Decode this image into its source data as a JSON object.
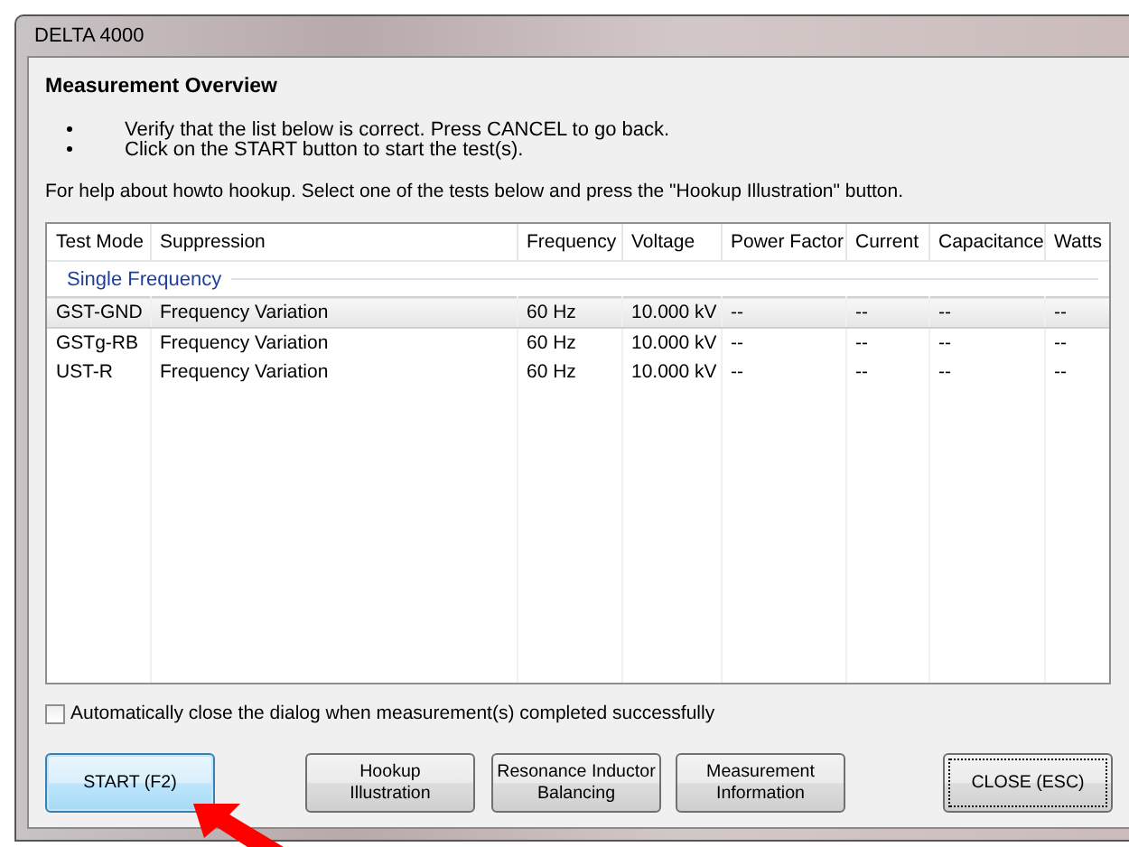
{
  "window": {
    "title": "DELTA 4000"
  },
  "heading": "Measurement Overview",
  "bullets": [
    "Verify that the list below is correct. Press CANCEL to go back.",
    "Click on the START button to start the test(s)."
  ],
  "help_text": "For help about howto hookup. Select one of the tests below and press the \"Hookup Illustration\" button.",
  "table": {
    "columns": [
      "Test Mode",
      "Suppression",
      "Frequency",
      "Voltage",
      "Power Factor",
      "Current",
      "Capacitance",
      "Watts"
    ],
    "group": "Single Frequency",
    "rows": [
      {
        "selected": true,
        "cells": [
          "GST-GND",
          "Frequency Variation",
          "60 Hz",
          "10.000 kV",
          "--",
          "--",
          "--",
          "--"
        ]
      },
      {
        "selected": false,
        "cells": [
          "GSTg-RB",
          "Frequency Variation",
          "60 Hz",
          "10.000 kV",
          "--",
          "--",
          "--",
          "--"
        ]
      },
      {
        "selected": false,
        "cells": [
          "UST-R",
          "Frequency Variation",
          "60 Hz",
          "10.000 kV",
          "--",
          "--",
          "--",
          "--"
        ]
      }
    ]
  },
  "auto_close": {
    "label": "Automatically close the dialog when measurement(s) completed successfully",
    "checked": false
  },
  "buttons": [
    {
      "label": "START (F2)",
      "default": true,
      "focused": false
    },
    {
      "label": "Hookup\nIllustration",
      "default": false,
      "focused": false
    },
    {
      "label": "Resonance Inductor\nBalancing",
      "default": false,
      "focused": false
    },
    {
      "label": "Measurement\nInformation",
      "default": false,
      "focused": false
    },
    {
      "label": "CLOSE (ESC)",
      "default": false,
      "focused": true
    }
  ]
}
